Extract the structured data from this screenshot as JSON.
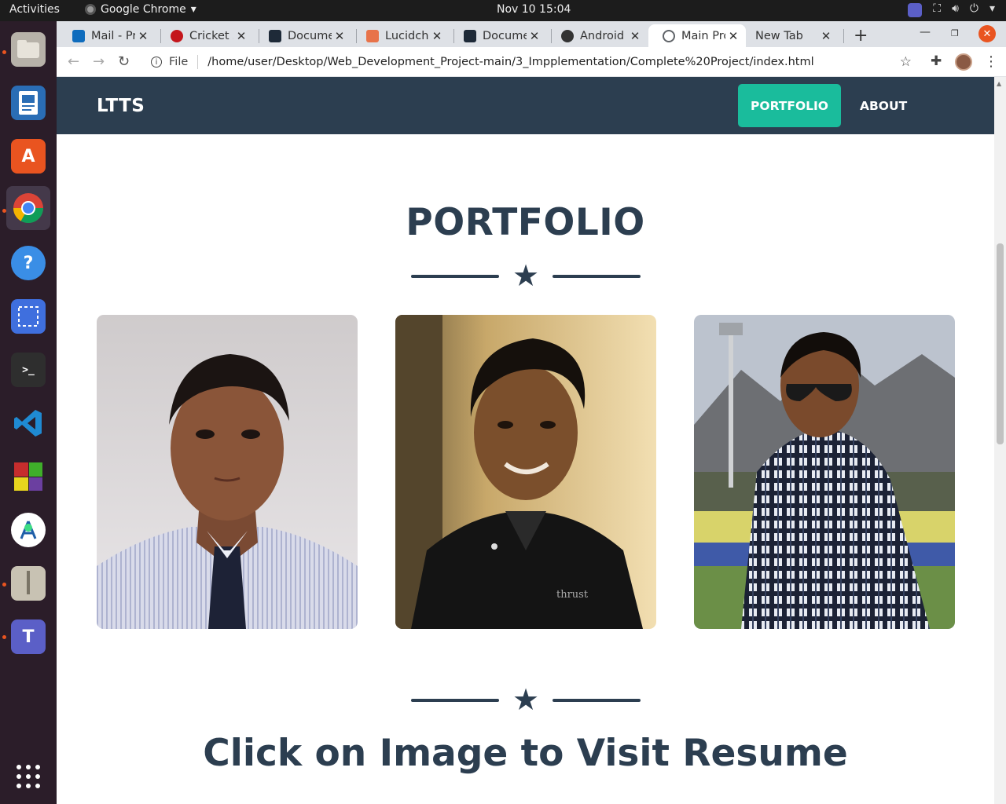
{
  "system": {
    "activities": "Activities",
    "app_menu_label": "Google Chrome",
    "clock": "Nov 10  15:04"
  },
  "dock": {
    "items": [
      {
        "name": "files-icon",
        "color": "#b7b2a9"
      },
      {
        "name": "libreoffice-writer-icon",
        "color": "#2a6db5"
      },
      {
        "name": "ubuntu-software-icon",
        "color": "#e95420"
      },
      {
        "name": "chrome-icon",
        "color": "#4285f4"
      },
      {
        "name": "help-icon",
        "color": "#3a8ee6"
      },
      {
        "name": "screenshot-icon",
        "color": "#3f6fde"
      },
      {
        "name": "terminal-icon",
        "color": "#2e2e2e"
      },
      {
        "name": "vscode-icon",
        "color": "#1f8ad2"
      },
      {
        "name": "rubik-cube-icon",
        "color": "#c62d2d"
      },
      {
        "name": "android-studio-icon",
        "color": "#ffffff"
      },
      {
        "name": "archive-manager-icon",
        "color": "#c8c2b3"
      },
      {
        "name": "teams-icon",
        "color": "#5b5fc7"
      },
      {
        "name": "app-grid-icon",
        "color": "#ffffff"
      }
    ]
  },
  "browser": {
    "tabs": [
      {
        "title": "Mail - Pra",
        "favicon_color": "#0f6cbd"
      },
      {
        "title": "Cricket sc",
        "favicon_color": "#c4161c"
      },
      {
        "title": "Documen",
        "favicon_color": "#1e2a38"
      },
      {
        "title": "Lucidcha",
        "favicon_color": "#e8734a"
      },
      {
        "title": "Documen",
        "favicon_color": "#1e2a38"
      },
      {
        "title": "Android",
        "favicon_color": "#333333"
      },
      {
        "title": "Main Pro",
        "favicon_color": "#5f6368"
      },
      {
        "title": "New Tab",
        "favicon_color": ""
      }
    ],
    "new_tab_symbol": "+",
    "url_scheme": "File",
    "url": "/home/user/Desktop/Web_Development_Project-main/3_Impplementation/Complete%20Project/index.html"
  },
  "page": {
    "brand": "LTTS",
    "nav": {
      "portfolio": "PORTFOLIO",
      "about": "ABOUT"
    },
    "section_title": "PORTFOLIO",
    "cta_title": "Click on Image to Visit Resume",
    "accent_color": "#1abc9c",
    "primary_color": "#2c3e50",
    "portfolio_items": [
      {
        "name": "portfolio-photo-formal-shirt-tie"
      },
      {
        "name": "portfolio-photo-black-polo"
      },
      {
        "name": "portfolio-photo-checked-shirt-stadium"
      }
    ]
  }
}
